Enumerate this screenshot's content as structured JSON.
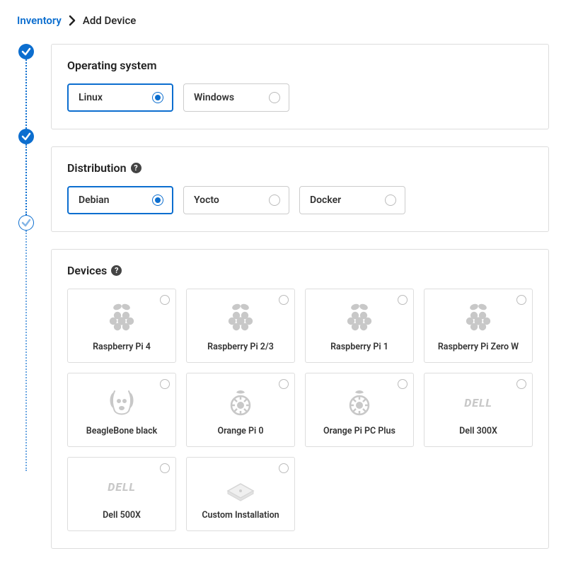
{
  "breadcrumb": {
    "link": "Inventory",
    "current": "Add Device"
  },
  "steps": [
    {
      "state": "done"
    },
    {
      "state": "done"
    },
    {
      "state": "pending"
    }
  ],
  "os": {
    "title": "Operating system",
    "options": [
      {
        "label": "Linux",
        "selected": true
      },
      {
        "label": "Windows",
        "selected": false
      }
    ]
  },
  "distribution": {
    "title": "Distribution",
    "options": [
      {
        "label": "Debian",
        "selected": true
      },
      {
        "label": "Yocto",
        "selected": false
      },
      {
        "label": "Docker",
        "selected": false
      }
    ]
  },
  "devices": {
    "title": "Devices",
    "options": [
      {
        "label": "Raspberry Pi 4",
        "icon": "raspberry",
        "selected": false
      },
      {
        "label": "Raspberry Pi 2/3",
        "icon": "raspberry",
        "selected": false
      },
      {
        "label": "Raspberry Pi 1",
        "icon": "raspberry",
        "selected": false
      },
      {
        "label": "Raspberry Pi Zero W",
        "icon": "raspberry",
        "selected": false
      },
      {
        "label": "BeagleBone black",
        "icon": "beagle",
        "selected": false
      },
      {
        "label": "Orange Pi 0",
        "icon": "orange",
        "selected": false
      },
      {
        "label": "Orange Pi PC Plus",
        "icon": "orange",
        "selected": false
      },
      {
        "label": "Dell 300X",
        "icon": "dell",
        "selected": false
      },
      {
        "label": "Dell 500X",
        "icon": "dell",
        "selected": false
      },
      {
        "label": "Custom Installation",
        "icon": "custom",
        "selected": false
      }
    ]
  },
  "icons": {
    "dell_text": "DELL"
  }
}
